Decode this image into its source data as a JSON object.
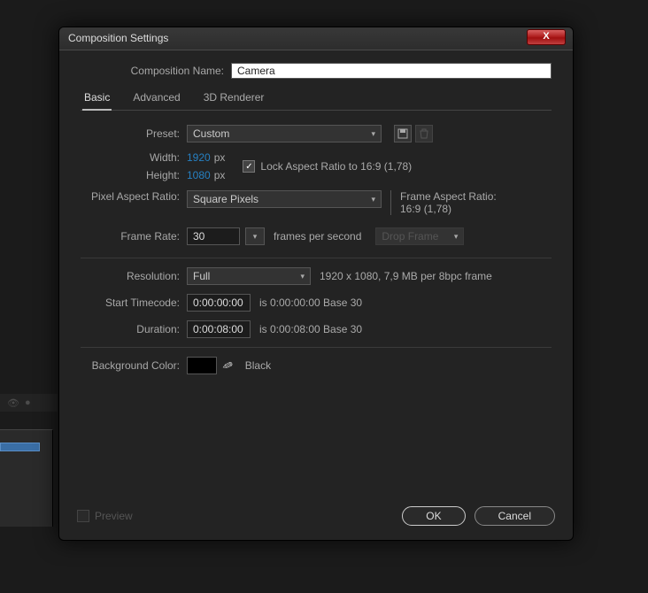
{
  "dialog": {
    "title": "Composition Settings",
    "close_glyph": "X",
    "comp_name_label": "Composition Name:",
    "comp_name_value": "Camera",
    "tabs": {
      "basic": "Basic",
      "advanced": "Advanced",
      "renderer": "3D Renderer"
    },
    "preset": {
      "label": "Preset:",
      "value": "Custom"
    },
    "width_label": "Width:",
    "width_value": "1920",
    "width_unit": "px",
    "height_label": "Height:",
    "height_value": "1080",
    "height_unit": "px",
    "lock_ar_label": "Lock Aspect Ratio to 16:9 (1,78)",
    "par": {
      "label": "Pixel Aspect Ratio:",
      "value": "Square Pixels"
    },
    "far_label": "Frame Aspect Ratio:",
    "far_value": "16:9 (1,78)",
    "frame_rate": {
      "label": "Frame Rate:",
      "value": "30",
      "suffix": "frames per second",
      "drop": "Drop Frame"
    },
    "resolution": {
      "label": "Resolution:",
      "value": "Full",
      "info": "1920 x 1080, 7,9 MB per 8bpc frame"
    },
    "start_tc": {
      "label": "Start Timecode:",
      "value": "0:00:00:00",
      "info": "is 0:00:00:00  Base 30"
    },
    "duration": {
      "label": "Duration:",
      "value": "0:00:08:00",
      "info": "is 0:00:08:00  Base 30"
    },
    "bg": {
      "label": "Background Color:",
      "name": "Black"
    },
    "preview_label": "Preview",
    "ok": "OK",
    "cancel": "Cancel"
  }
}
